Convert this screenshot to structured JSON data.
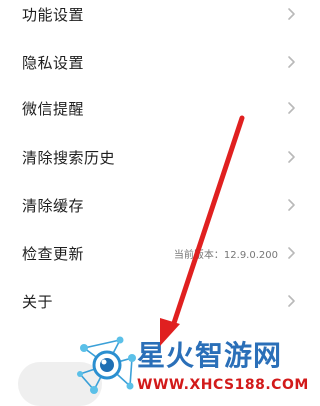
{
  "settings": {
    "items": [
      {
        "label": "功能设置",
        "sub": ""
      },
      {
        "label": "隐私设置",
        "sub": ""
      },
      {
        "label": "微信提醒",
        "sub": ""
      },
      {
        "label": "清除搜索历史",
        "sub": ""
      },
      {
        "label": "清除缓存",
        "sub": ""
      },
      {
        "label": "检查更新",
        "sub": "当前版本：12.9.0.200"
      },
      {
        "label": "关于",
        "sub": ""
      }
    ]
  },
  "watermark": {
    "title": "星火智游网",
    "url": "WWW.XHCS188.COM"
  },
  "colors": {
    "arrow": "#e02020",
    "watermark_title": "#2a6fb8",
    "watermark_url": "#d21a1a"
  },
  "icons": {
    "chevron": "chevron-right-icon",
    "logo": "network-logo-icon"
  }
}
